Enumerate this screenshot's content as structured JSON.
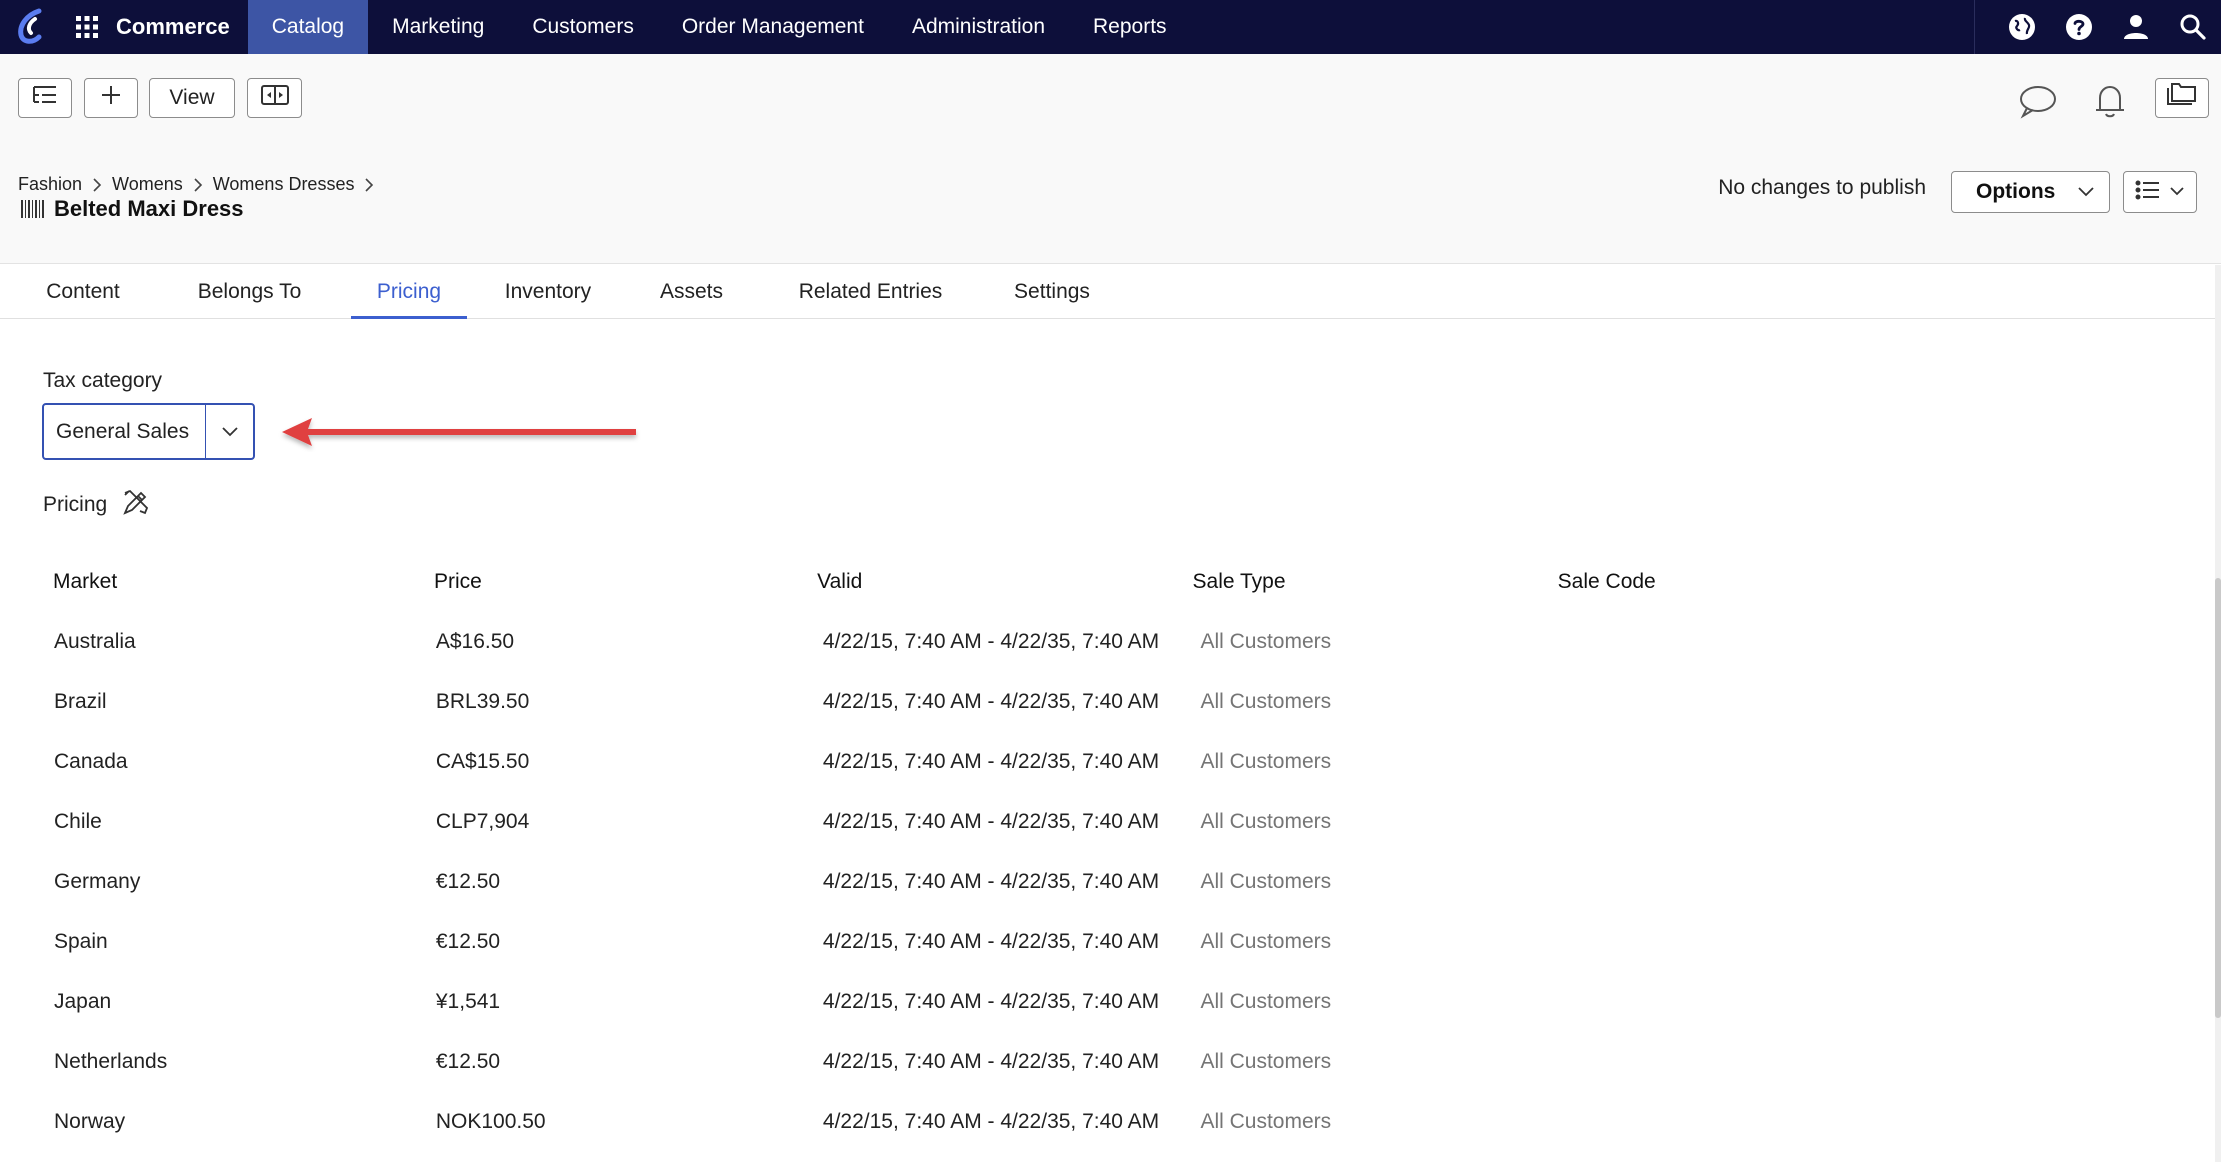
{
  "topnav": {
    "app_name": "Commerce",
    "items": [
      {
        "label": "Catalog",
        "active": true
      },
      {
        "label": "Marketing"
      },
      {
        "label": "Customers"
      },
      {
        "label": "Order Management"
      },
      {
        "label": "Administration"
      },
      {
        "label": "Reports"
      }
    ],
    "right_icons": [
      "globe-icon",
      "help-icon",
      "user-icon",
      "search-icon"
    ]
  },
  "toolbar": {
    "view_label": "View",
    "right_icons": [
      "comment-icon",
      "bell-icon",
      "folders-icon"
    ]
  },
  "breadcrumb": [
    "Fashion",
    "Womens",
    "Womens Dresses"
  ],
  "page_title": "Belted Maxi Dress",
  "publish_status": "No changes to publish",
  "options_label": "Options",
  "tabs": [
    {
      "label": "Content"
    },
    {
      "label": "Belongs To"
    },
    {
      "label": "Pricing",
      "active": true
    },
    {
      "label": "Inventory"
    },
    {
      "label": "Assets"
    },
    {
      "label": "Related Entries"
    },
    {
      "label": "Settings"
    }
  ],
  "tax_category": {
    "label": "Tax category",
    "value": "General Sales"
  },
  "pricing": {
    "label": "Pricing",
    "columns": [
      "Market",
      "Price",
      "Valid",
      "Sale Type",
      "Sale Code"
    ],
    "rows": [
      {
        "market": "Australia",
        "price": "A$16.50",
        "valid": "4/22/15, 7:40 AM - 4/22/35, 7:40 AM",
        "sale_type": "All Customers",
        "sale_code": ""
      },
      {
        "market": "Brazil",
        "price": "BRL39.50",
        "valid": "4/22/15, 7:40 AM - 4/22/35, 7:40 AM",
        "sale_type": "All Customers",
        "sale_code": ""
      },
      {
        "market": "Canada",
        "price": "CA$15.50",
        "valid": "4/22/15, 7:40 AM - 4/22/35, 7:40 AM",
        "sale_type": "All Customers",
        "sale_code": ""
      },
      {
        "market": "Chile",
        "price": "CLP7,904",
        "valid": "4/22/15, 7:40 AM - 4/22/35, 7:40 AM",
        "sale_type": "All Customers",
        "sale_code": ""
      },
      {
        "market": "Germany",
        "price": "€12.50",
        "valid": "4/22/15, 7:40 AM - 4/22/35, 7:40 AM",
        "sale_type": "All Customers",
        "sale_code": ""
      },
      {
        "market": "Spain",
        "price": "€12.50",
        "valid": "4/22/15, 7:40 AM - 4/22/35, 7:40 AM",
        "sale_type": "All Customers",
        "sale_code": ""
      },
      {
        "market": "Japan",
        "price": "¥1,541",
        "valid": "4/22/15, 7:40 AM - 4/22/35, 7:40 AM",
        "sale_type": "All Customers",
        "sale_code": ""
      },
      {
        "market": "Netherlands",
        "price": "€12.50",
        "valid": "4/22/15, 7:40 AM - 4/22/35, 7:40 AM",
        "sale_type": "All Customers",
        "sale_code": ""
      },
      {
        "market": "Norway",
        "price": "NOK100.50",
        "valid": "4/22/15, 7:40 AM - 4/22/35, 7:40 AM",
        "sale_type": "All Customers",
        "sale_code": ""
      }
    ]
  },
  "colors": {
    "nav_bg": "#0d0f3a",
    "nav_active": "#3d55a5",
    "accent": "#3c5fcf",
    "arrow": "#e04040"
  }
}
